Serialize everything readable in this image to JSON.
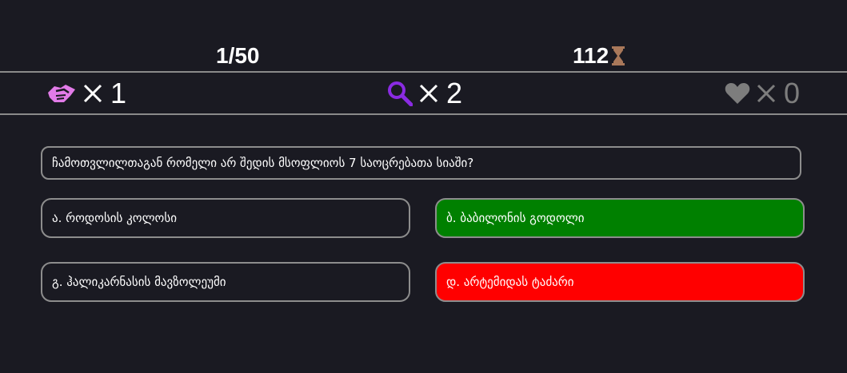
{
  "status": {
    "progress": "1/50",
    "timer": "112"
  },
  "lifelines": [
    {
      "icon": "handshake-icon",
      "color": "#e27be8",
      "multiplier": "X",
      "count": "1"
    },
    {
      "icon": "magnifier-icon",
      "color": "#8a2be2",
      "multiplier": "X",
      "count": "2"
    },
    {
      "icon": "heart-icon",
      "color": "#7d7d7d",
      "multiplier": "X",
      "count": "0"
    }
  ],
  "question": {
    "text": "ჩამოთვლილთაგან რომელი არ შედის მსოფლიოს 7 საოცრებათა სიაში?"
  },
  "answers": [
    {
      "text": "ა. როდოსის კოლოსი",
      "state": "default"
    },
    {
      "text": "ბ. ბაბილონის გოდოლი",
      "state": "correct",
      "color": "#008000"
    },
    {
      "text": "გ. ჰალიკარნასის მავზოლეუმი",
      "state": "default"
    },
    {
      "text": "დ. არტემიდას ტაძარი",
      "state": "wrong",
      "color": "#ff0000"
    }
  ],
  "colors": {
    "background": "#1a1a22",
    "border": "#8d8d8d",
    "hourglass": "#a9785a"
  }
}
